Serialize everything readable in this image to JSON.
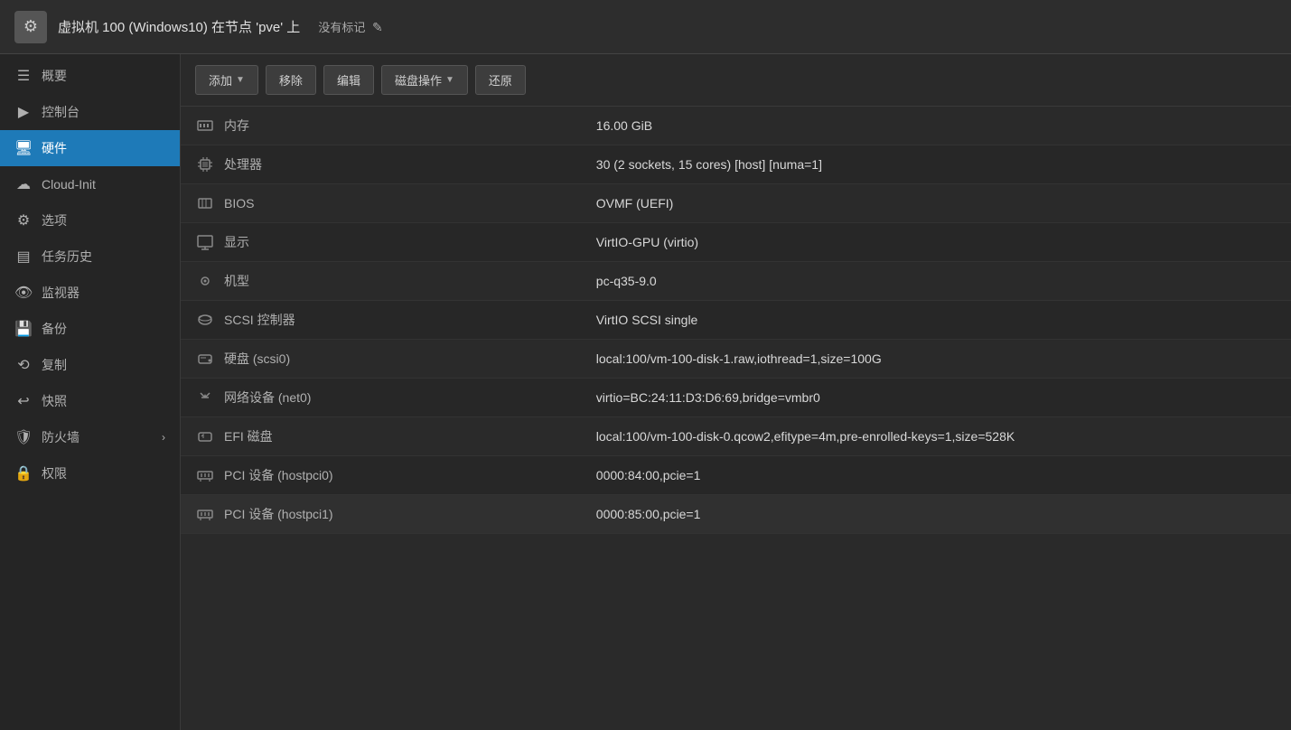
{
  "topbar": {
    "title": "虚拟机 100 (Windows10) 在节点 'pve' 上",
    "tag": "没有标记",
    "edit_icon": "✎"
  },
  "sidebar": {
    "items": [
      {
        "id": "overview",
        "label": "概要",
        "icon": "☰",
        "active": false
      },
      {
        "id": "console",
        "label": "控制台",
        "icon": ">",
        "active": false
      },
      {
        "id": "hardware",
        "label": "硬件",
        "icon": "🖥",
        "active": true
      },
      {
        "id": "cloudinit",
        "label": "Cloud-Init",
        "icon": "☁",
        "active": false
      },
      {
        "id": "options",
        "label": "选项",
        "icon": "⚙",
        "active": false
      },
      {
        "id": "taskhistory",
        "label": "任务历史",
        "icon": "▤",
        "active": false
      },
      {
        "id": "monitor",
        "label": "监视器",
        "icon": "👁",
        "active": false
      },
      {
        "id": "backup",
        "label": "备份",
        "icon": "💾",
        "active": false
      },
      {
        "id": "replicate",
        "label": "复制",
        "icon": "⟲",
        "active": false
      },
      {
        "id": "snapshot",
        "label": "快照",
        "icon": "↩",
        "active": false
      },
      {
        "id": "firewall",
        "label": "防火墙",
        "icon": "🛡",
        "active": false,
        "arrow": "›"
      },
      {
        "id": "permissions",
        "label": "权限",
        "icon": "🔒",
        "active": false
      }
    ]
  },
  "toolbar": {
    "add_label": "添加",
    "remove_label": "移除",
    "edit_label": "编辑",
    "disk_ops_label": "磁盘操作",
    "restore_label": "还原"
  },
  "hardware_rows": [
    {
      "id": "memory",
      "icon": "mem",
      "label": "内存",
      "value": "16.00 GiB"
    },
    {
      "id": "cpu",
      "icon": "cpu",
      "label": "处理器",
      "value": "30 (2 sockets, 15 cores) [host] [numa=1]"
    },
    {
      "id": "bios",
      "icon": "bios",
      "label": "BIOS",
      "value": "OVMF (UEFI)"
    },
    {
      "id": "display",
      "icon": "display",
      "label": "显示",
      "value": "VirtIO-GPU (virtio)"
    },
    {
      "id": "machine",
      "icon": "machine",
      "label": "机型",
      "value": "pc-q35-9.0"
    },
    {
      "id": "scsi",
      "icon": "scsi",
      "label": "SCSI 控制器",
      "value": "VirtIO SCSI single"
    },
    {
      "id": "harddisk",
      "icon": "hdd",
      "label": "硬盘 (scsi0)",
      "value": "local:100/vm-100-disk-1.raw,iothread=1,size=100G"
    },
    {
      "id": "network",
      "icon": "net",
      "label": "网络设备 (net0)",
      "value": "virtio=BC:24:11:D3:D6:69,bridge=vmbr0"
    },
    {
      "id": "efi",
      "icon": "efi",
      "label": "EFI 磁盘",
      "value": "local:100/vm-100-disk-0.qcow2,efitype=4m,pre-enrolled-keys=1,size=528K"
    },
    {
      "id": "pci0",
      "icon": "pci",
      "label": "PCI 设备 (hostpci0)",
      "value": "0000:84:00,pcie=1"
    },
    {
      "id": "pci1",
      "icon": "pci",
      "label": "PCI 设备 (hostpci1)",
      "value": "0000:85:00,pcie=1"
    }
  ]
}
